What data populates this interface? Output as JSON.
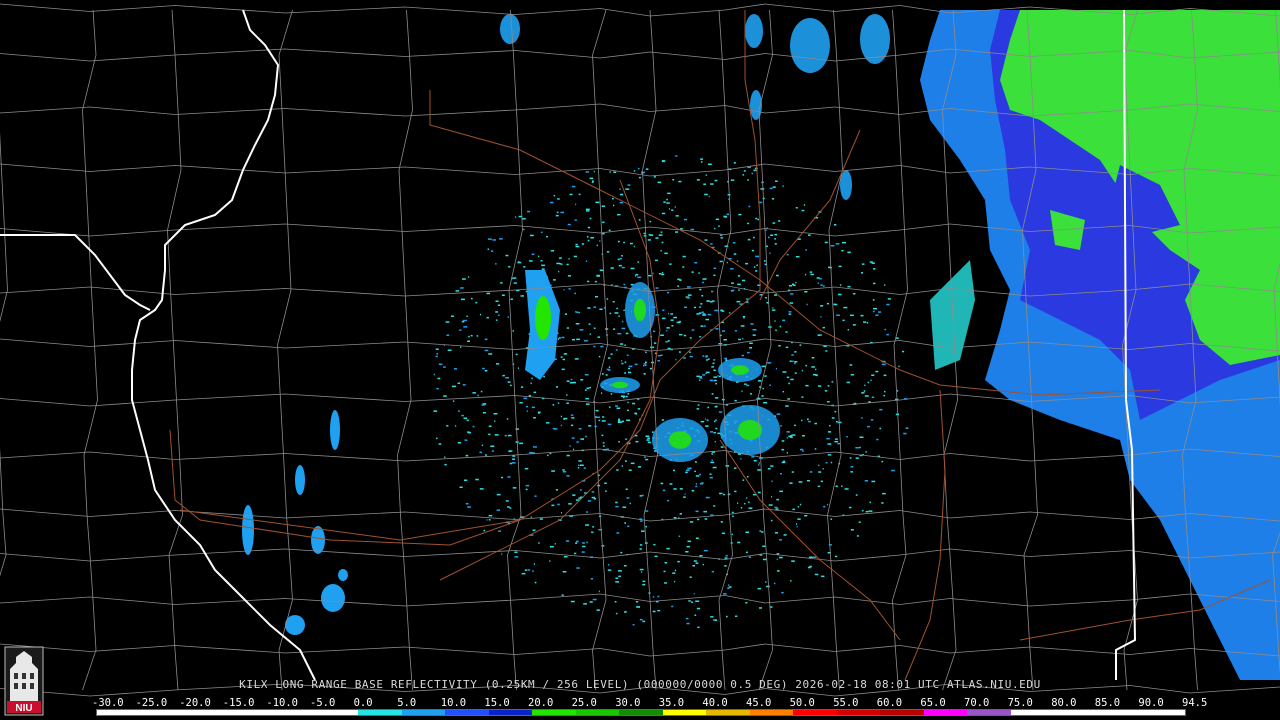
{
  "product_caption": "KILX LONG RANGE BASE REFLECTIVITY (0.25KM / 256 LEVEL) (000000/0000 0.5 DEG) 2026-02-18 08:01 UTC  ATLAS.NIU.EDU",
  "logo_text": "NIU",
  "scale": {
    "labels": [
      "-30.0",
      "-25.0",
      "-20.0",
      "-15.0",
      "-10.0",
      "-5.0",
      "0.0",
      "5.0",
      "10.0",
      "15.0",
      "20.0",
      "25.0",
      "30.0",
      "35.0",
      "40.0",
      "45.0",
      "50.0",
      "55.0",
      "60.0",
      "65.0",
      "70.0",
      "75.0",
      "80.0",
      "85.0",
      "90.0",
      "94.5"
    ],
    "colors": [
      "#ffffff",
      "#ffffff",
      "#ffffff",
      "#ffffff",
      "#ffffff",
      "#ffffff",
      "#29e3e3",
      "#1fa0f0",
      "#2250ff",
      "#0a23c8",
      "#22e600",
      "#19c800",
      "#128c00",
      "#ffff00",
      "#e6b800",
      "#ff8000",
      "#ff0000",
      "#d40000",
      "#b80000",
      "#ff00ff",
      "#9a55c9",
      "#ffffff",
      "#ffffff",
      "#ffffff",
      "#ffffff"
    ]
  },
  "map_colors": {
    "background": "#000000",
    "county_lines": "#8c8c8c",
    "state_lines": "#ffffff",
    "highways": "#a0522d"
  }
}
